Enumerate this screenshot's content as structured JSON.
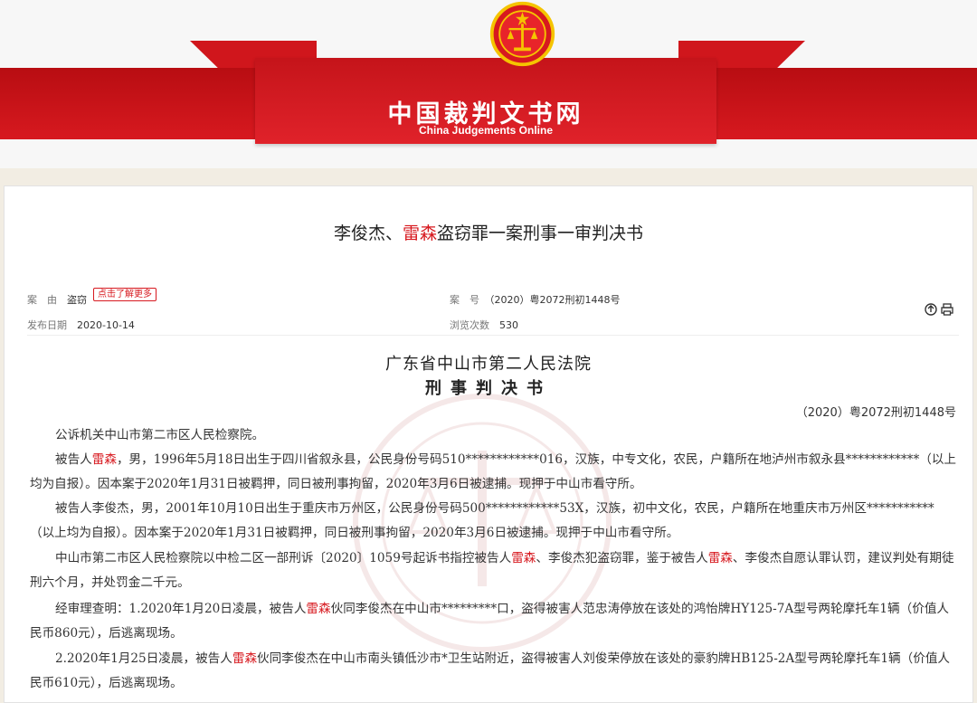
{
  "banner": {
    "title": "中国裁判文书网",
    "subtitle": "China Judgements Online"
  },
  "header": {
    "title_pre": "李俊杰、",
    "title_hl": "雷森",
    "title_post": "盗窃罪一案刑事一审判决书"
  },
  "meta": {
    "cause_label": "案　由",
    "cause_value": "盗窃",
    "more_tag": "点击了解更多",
    "caseno_label": "案　号",
    "caseno_value": "（2020）粤2072刑初1448号",
    "date_label": "发布日期",
    "date_value": "2020-10-14",
    "views_label": "浏览次数",
    "views_value": "530"
  },
  "icons": [
    "share-icon",
    "print-icon"
  ],
  "colors": {
    "accent": "#d7191f",
    "banner": "#c5141a"
  },
  "body": {
    "court": "广东省中山市第二人民法院",
    "doctype": "刑事判决书",
    "caseno": "（2020）粤2072刑初1448号",
    "p1": "公诉机关中山市第二市区人民检察院。",
    "p2_a": "被告人",
    "p2_hl": "雷森",
    "p2_b": "，男，1996年5月18日出生于四川省叙永县，公民身份号码510************016，汉族，中专文化，农民，户籍所在地泸州市叙永县************（以上均为自报）。因本案于2020年1月31日被羁押，同日被刑事拘留，2020年3月6日被逮捕。现押于中山市看守所。",
    "p3": "被告人李俊杰，男，2001年10月10日出生于重庆市万州区，公民身份号码500************53X，汉族，初中文化，农民，户籍所在地重庆市万州区***********（以上均为自报）。因本案于2020年1月31日被羁押，同日被刑事拘留，2020年3月6日被逮捕。现押于中山市看守所。",
    "p4_a": "中山市第二市区人民检察院以中检二区一部刑诉〔2020〕1059号起诉书指控被告人",
    "p4_hl1": "雷森",
    "p4_b": "、李俊杰犯盗窃罪，鉴于被告人",
    "p4_hl2": "雷森",
    "p4_c": "、李俊杰自愿认罪认罚，建议判处有期徒刑六个月，并处罚金二千元。",
    "p5_a": "经审理查明：1.2020年1月20日凌晨，被告人",
    "p5_hl": "雷森",
    "p5_b": "伙同李俊杰在中山市*********口，盗得被害人范忠涛停放在该处的鸿怡牌HY125-7A型号两轮摩托车1辆（价值人民币860元），后逃离现场。",
    "p6_a": "2.2020年1月25日凌晨，被告人",
    "p6_hl": "雷森",
    "p6_b": "伙同李俊杰在中山市南头镇低沙市*卫生站附近，盗得被害人刘俊荣停放在该处的豪豹牌HB125-2A型号两轮摩托车1辆（价值人民币610元），后逃离现场。"
  }
}
